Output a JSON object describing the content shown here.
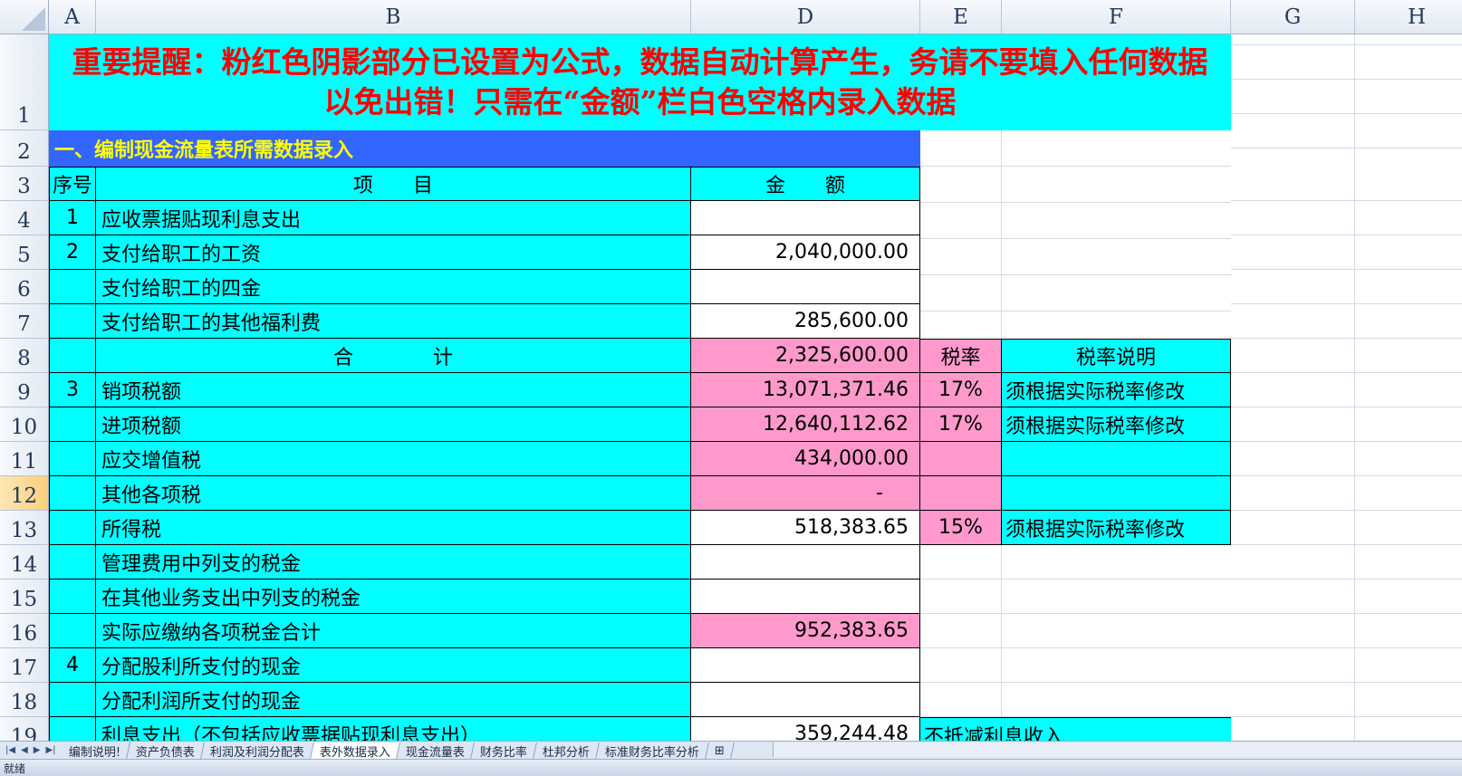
{
  "columns": [
    "A",
    "B",
    "D",
    "E",
    "F",
    "G",
    "H"
  ],
  "rows": [
    "1",
    "2",
    "3",
    "4",
    "5",
    "6",
    "7",
    "8",
    "9",
    "10",
    "11",
    "12",
    "13",
    "14",
    "15",
    "16",
    "17",
    "18",
    "19"
  ],
  "selected_row": "12",
  "banner": "重要提醒：粉红色阴影部分已设置为公式，数据自动计算产生，务请不要填入任何数据以免出错！只需在“金额”栏白色空格内录入数据",
  "section_title": "一、编制现金流量表所需数据录入",
  "headers": {
    "seq": "序号",
    "item": "项　　目",
    "amount": "金　　额",
    "rate": "税率",
    "rate_note": "税率说明"
  },
  "table": [
    {
      "seq": "1",
      "item": "应收票据贴现利息支出",
      "amount": ""
    },
    {
      "seq": "2",
      "item": "支付给职工的工资",
      "amount": "2,040,000.00"
    },
    {
      "seq": "",
      "item": "支付给职工的四金",
      "amount": ""
    },
    {
      "seq": "",
      "item": "支付给职工的其他福利费",
      "amount": "285,600.00"
    },
    {
      "seq": "",
      "item": "合　　　　计",
      "amount": "2,325,600.00"
    },
    {
      "seq": "3",
      "item": "销项税额",
      "amount": "13,071,371.46",
      "rate": "17%",
      "note": "须根据实际税率修改"
    },
    {
      "seq": "",
      "item": "进项税额",
      "amount": "12,640,112.62",
      "rate": "17%",
      "note": "须根据实际税率修改"
    },
    {
      "seq": "",
      "item": "应交增值税",
      "amount": "434,000.00"
    },
    {
      "seq": "",
      "item": "其他各项税",
      "amount": "-"
    },
    {
      "seq": "",
      "item": "所得税",
      "amount": "518,383.65",
      "rate": "15%",
      "note": "须根据实际税率修改"
    },
    {
      "seq": "",
      "item": "管理费用中列支的税金",
      "amount": ""
    },
    {
      "seq": "",
      "item": "在其他业务支出中列支的税金",
      "amount": ""
    },
    {
      "seq": "",
      "item": "实际应缴纳各项税金合计",
      "amount": "952,383.65"
    },
    {
      "seq": "4",
      "item": "分配股利所支付的现金",
      "amount": ""
    },
    {
      "seq": "",
      "item": "分配利润所支付的现金",
      "amount": ""
    },
    {
      "seq": "",
      "item": "利息支出（不包括应收票据贴现利息支出）",
      "amount": "359,244.48",
      "rate": "不抵减利息收入"
    }
  ],
  "sheet_tabs": [
    "编制说明!",
    "资产负债表",
    "利润及利润分配表",
    "表外数据录入",
    "现金流量表",
    "财务比率",
    "杜邦分析",
    "标准财务比率分析"
  ],
  "active_tab": "表外数据录入",
  "status": "就绪",
  "colors": {
    "cyan": "#00ffff",
    "pink": "#ff99cc",
    "blue": "#3366ff",
    "red_text": "#ff0000",
    "yellow_text": "#ffff00"
  }
}
